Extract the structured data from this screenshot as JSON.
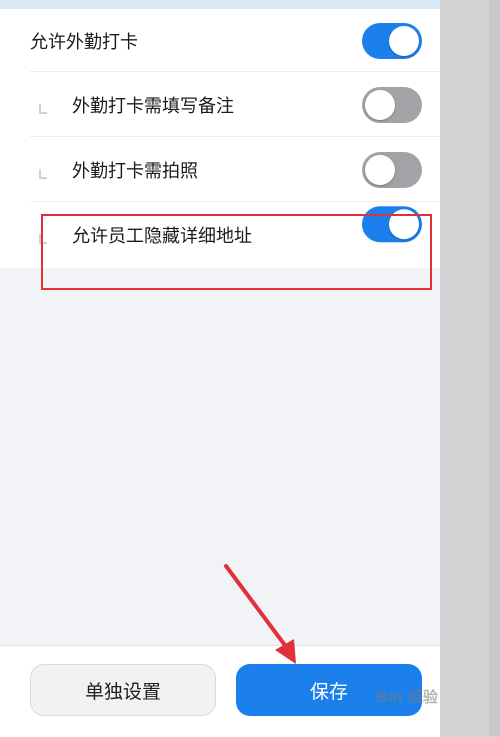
{
  "settings": {
    "allow_outside_checkin": {
      "label": "允许外勤打卡",
      "on": true
    },
    "outside_note_required": {
      "label": "外勤打卡需填写备注",
      "on": false
    },
    "outside_photo_required": {
      "label": "外勤打卡需拍照",
      "on": false
    },
    "allow_hide_address": {
      "label": "允许员工隐藏详细地址",
      "on": true
    }
  },
  "bottom": {
    "individual_label": "单独设置",
    "save_label": "保存"
  },
  "watermark": "Bai 经验",
  "colors": {
    "accent": "#1b80ec",
    "toggle_off": "#a3a3a7",
    "annotation_red": "#e0303a"
  }
}
